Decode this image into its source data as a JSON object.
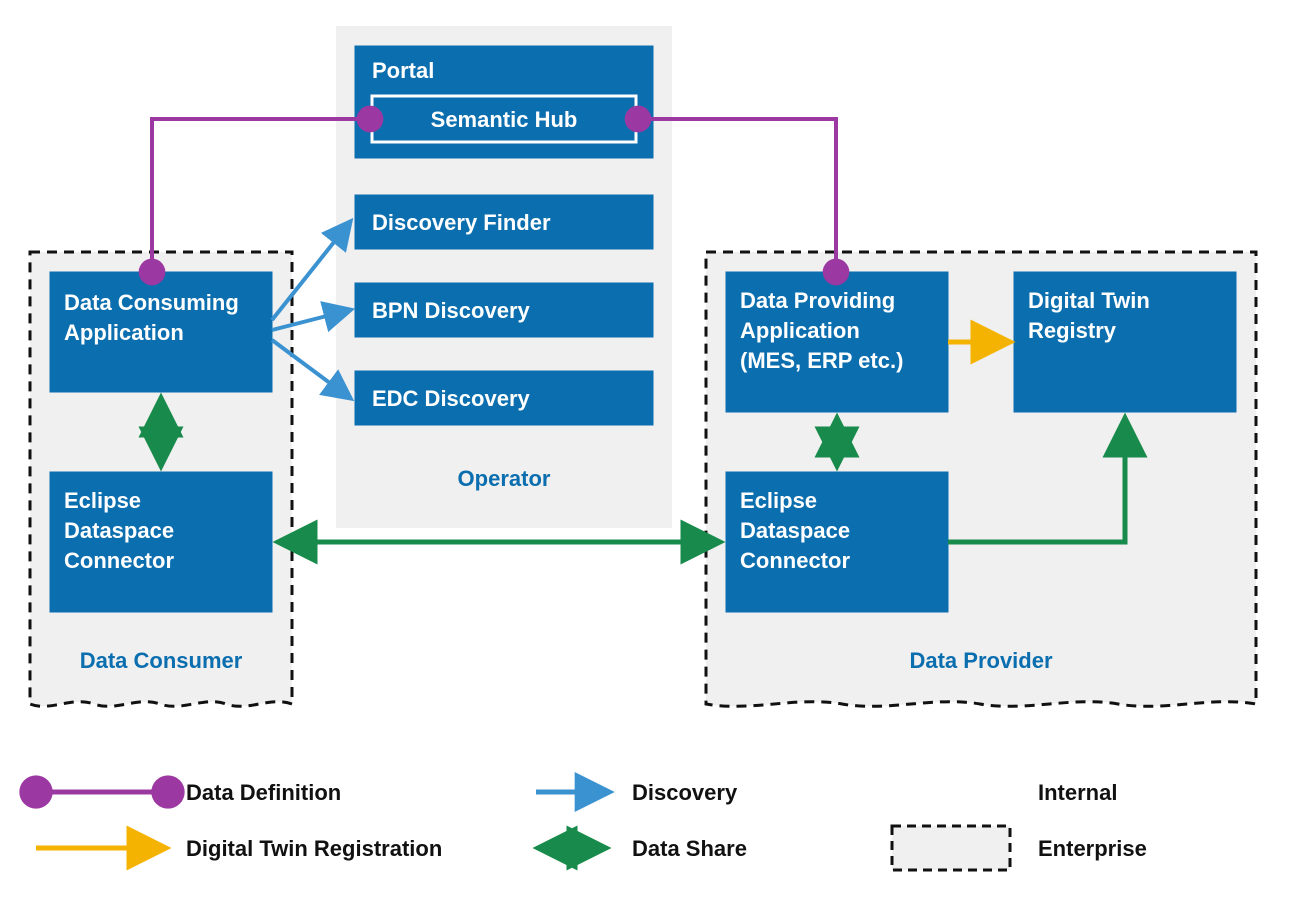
{
  "colors": {
    "blue": "#0b6eaf",
    "lightBlue": "#3b92d1",
    "purple": "#9b38a1",
    "green": "#178a4c",
    "yellow": "#f5b301",
    "panel": "#f0f0f0",
    "dash": "#111"
  },
  "consumer": {
    "title": "Data Consumer",
    "app_l1": "Data Consuming",
    "app_l2": "Application",
    "edc_l1": "Eclipse",
    "edc_l2": "Dataspace",
    "edc_l3": "Connector"
  },
  "operator": {
    "title": "Operator",
    "portal": "Portal",
    "semantic": "Semantic Hub",
    "discovery_finder": "Discovery Finder",
    "bpn_discovery": "BPN Discovery",
    "edc_discovery": "EDC Discovery"
  },
  "provider": {
    "title": "Data Provider",
    "app_l1": "Data Providing",
    "app_l2": "Application",
    "app_l3": "(MES, ERP etc.)",
    "dtr_l1": "Digital Twin",
    "dtr_l2": "Registry",
    "edc_l1": "Eclipse",
    "edc_l2": "Dataspace",
    "edc_l3": "Connector"
  },
  "legend": {
    "data_definition": "Data Definition",
    "discovery": "Discovery",
    "internal": "Internal",
    "dtr": "Digital Twin Registration",
    "data_share": "Data Share",
    "enterprise": "Enterprise"
  }
}
